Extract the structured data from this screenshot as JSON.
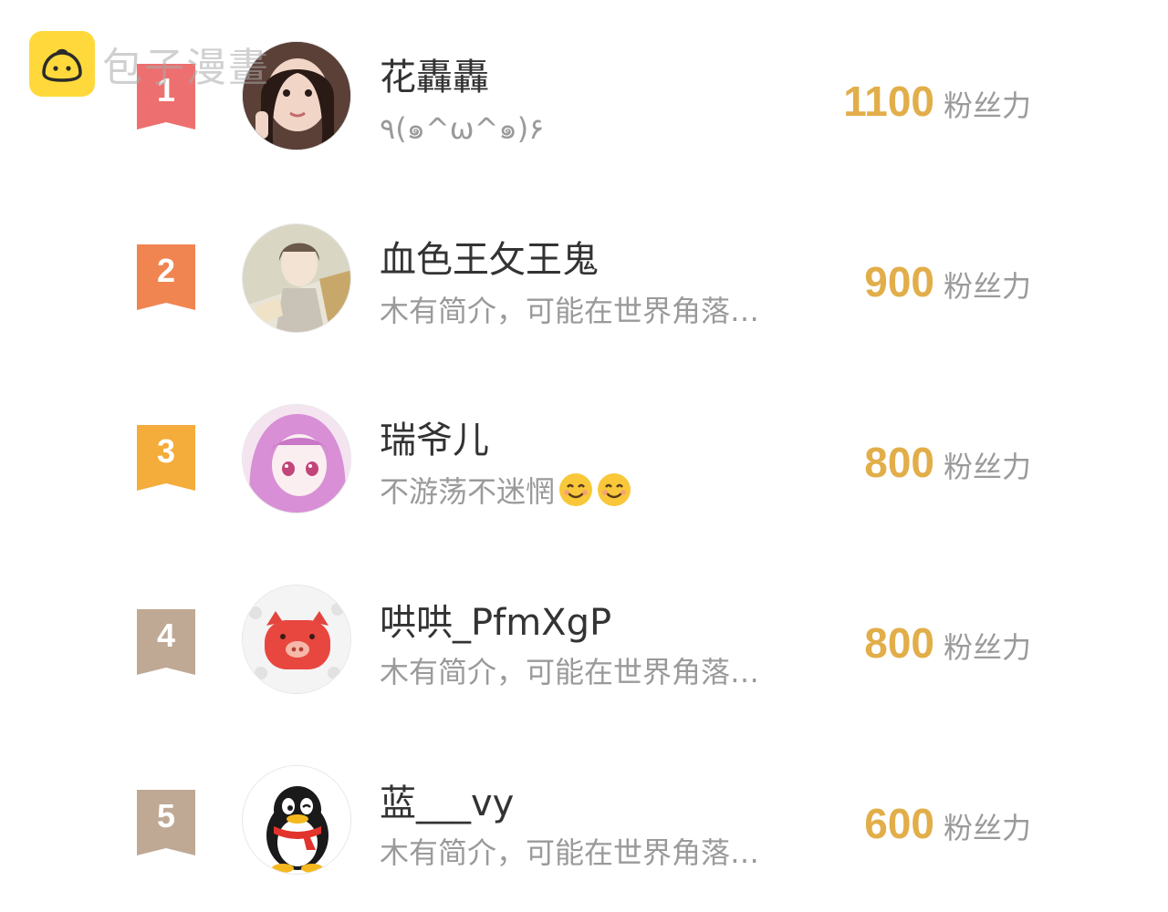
{
  "watermark": {
    "text": "包子漫畫"
  },
  "ranking": [
    {
      "rank": "1",
      "name": "花轟轟",
      "bio": "٩(๑^ω^๑)۶",
      "score": "1100",
      "unit": "粉丝力",
      "badge_color": "#ee6f6f",
      "avatar": "girl-photo"
    },
    {
      "rank": "2",
      "name": "血色王攵王鬼",
      "bio": "木有简介，可能在世界角落…",
      "score": "900",
      "unit": "粉丝力",
      "badge_color": "#f08552",
      "avatar": "anime-boy"
    },
    {
      "rank": "3",
      "name": "瑞爷儿",
      "bio": "不游荡不迷惘",
      "score": "800",
      "unit": "粉丝力",
      "badge_color": "#f4ac3a",
      "avatar": "anime-girl-pink"
    },
    {
      "rank": "4",
      "name": "哄哄_PfmXgP",
      "bio": "木有简介，可能在世界角落…",
      "score": "800",
      "unit": "粉丝力",
      "badge_color": "#bfa995",
      "avatar": "pig-cartoon"
    },
    {
      "rank": "5",
      "name": "蓝___vy",
      "bio": "木有简介，可能在世界角落…",
      "score": "600",
      "unit": "粉丝力",
      "badge_color": "#bfa995",
      "avatar": "qq-penguin"
    }
  ]
}
